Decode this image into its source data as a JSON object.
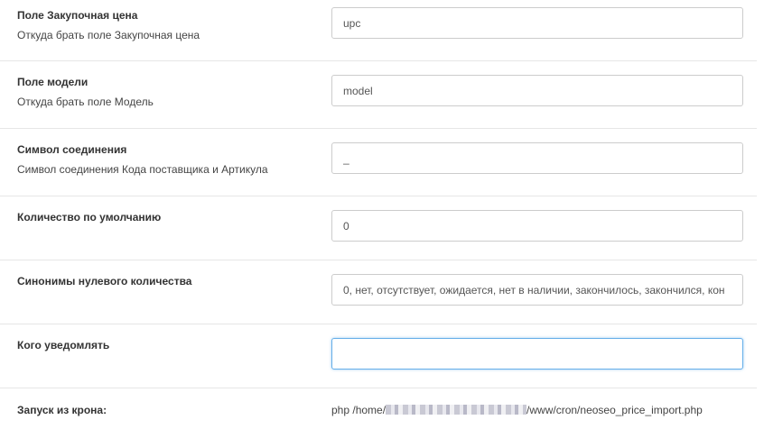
{
  "settings": {
    "purchase_price": {
      "title": "Поле Закупочная цена",
      "help": "Откуда брать поле Закупочная цена",
      "value": "upc"
    },
    "model": {
      "title": "Поле модели",
      "help": "Откуда брать поле Модель",
      "value": "model"
    },
    "join_symbol": {
      "title": "Символ соединения",
      "help": "Символ соединения Кода поставщика и Артикула",
      "value": "_"
    },
    "default_quantity": {
      "title": "Количество по умолчанию",
      "value": "0"
    },
    "zero_synonyms": {
      "title": "Синонимы нулевого количества",
      "value": "0, нет, отсутствует, ожидается, нет в наличии, закончилось, закончился, кон"
    },
    "notify": {
      "title": "Кого уведомлять",
      "value": ""
    },
    "cron": {
      "title": "Запуск из крона:",
      "path_prefix": "php /home/",
      "path_suffix": "/www/cron/neoseo_price_import.php"
    }
  }
}
